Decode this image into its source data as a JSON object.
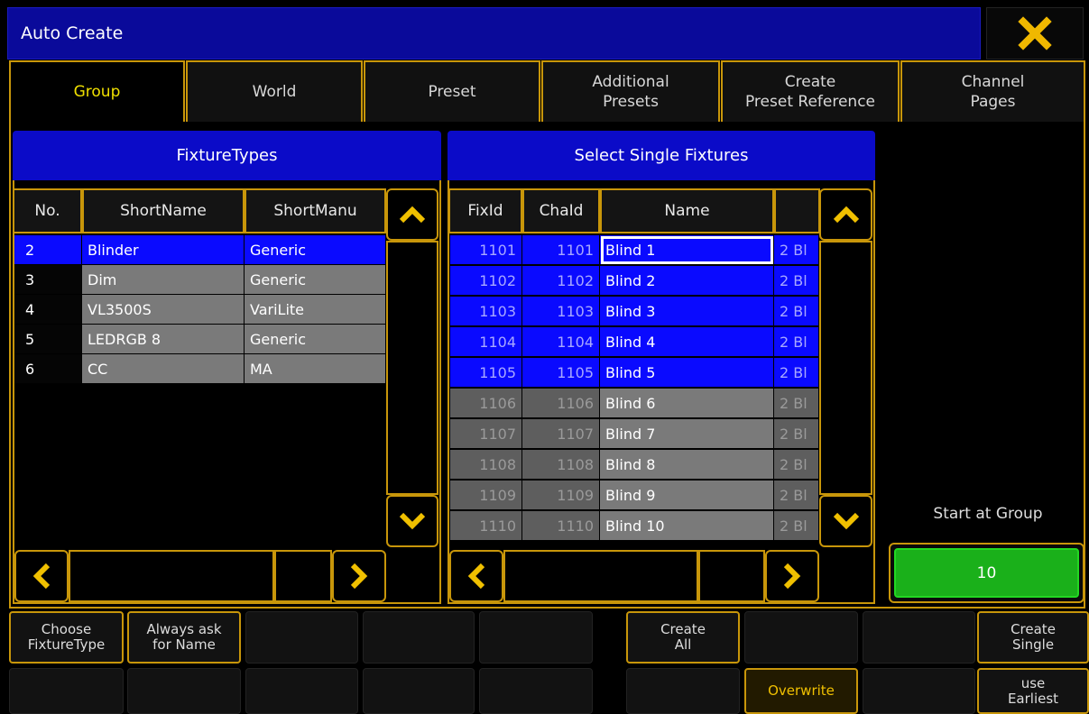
{
  "window": {
    "title": "Auto Create",
    "close_icon": "close-icon"
  },
  "tabs": [
    {
      "label": "Group",
      "active": true
    },
    {
      "label": "World"
    },
    {
      "label": "Preset"
    },
    {
      "label": "Additional\nPresets"
    },
    {
      "label": "Create\nPreset Reference"
    },
    {
      "label": "Channel\nPages"
    }
  ],
  "fixture_types": {
    "title": "FixtureTypes",
    "columns": [
      "No.",
      "ShortName",
      "ShortManu"
    ],
    "rows": [
      {
        "no": "2",
        "name": "Blinder",
        "manu": "Generic",
        "selected": true
      },
      {
        "no": "3",
        "name": "Dim",
        "manu": "Generic"
      },
      {
        "no": "4",
        "name": "VL3500S",
        "manu": "VariLite"
      },
      {
        "no": "5",
        "name": "LEDRGB 8",
        "manu": "Generic"
      },
      {
        "no": "6",
        "name": "CC",
        "manu": "MA"
      }
    ]
  },
  "single_fixtures": {
    "title": "Select Single Fixtures",
    "columns": [
      "FixId",
      "ChaId",
      "Name",
      ""
    ],
    "rows": [
      {
        "fix": "1101",
        "cha": "1101",
        "name": "Blind 1",
        "extra": "2 Bl",
        "selected": true,
        "focused": true
      },
      {
        "fix": "1102",
        "cha": "1102",
        "name": "Blind 2",
        "extra": "2 Bl",
        "selected": true
      },
      {
        "fix": "1103",
        "cha": "1103",
        "name": "Blind 3",
        "extra": "2 Bl",
        "selected": true
      },
      {
        "fix": "1104",
        "cha": "1104",
        "name": "Blind 4",
        "extra": "2 Bl",
        "selected": true
      },
      {
        "fix": "1105",
        "cha": "1105",
        "name": "Blind 5",
        "extra": "2 Bl",
        "selected": true
      },
      {
        "fix": "1106",
        "cha": "1106",
        "name": "Blind 6",
        "extra": "2 Bl"
      },
      {
        "fix": "1107",
        "cha": "1107",
        "name": "Blind 7",
        "extra": "2 Bl"
      },
      {
        "fix": "1108",
        "cha": "1108",
        "name": "Blind 8",
        "extra": "2 Bl"
      },
      {
        "fix": "1109",
        "cha": "1109",
        "name": "Blind 9",
        "extra": "2 Bl"
      },
      {
        "fix": "1110",
        "cha": "1110",
        "name": "Blind 10",
        "extra": "2 Bl"
      }
    ]
  },
  "start_at_group": {
    "label": "Start at Group",
    "value": "10"
  },
  "buttons": {
    "choose_fixture_type": "Choose\nFixtureType",
    "always_ask": "Always ask\nfor Name",
    "create_all": "Create\nAll",
    "create_single": "Create\nSingle",
    "overwrite": "Overwrite",
    "use_earliest": "use\nEarliest"
  },
  "colors": {
    "accent": "#c8960a",
    "title_bg": "#0a0a9a",
    "header_bg": "#0b0bc8",
    "selected_row": "#0a0aff",
    "unselected_row": "#7a7a7a",
    "active_tab_text": "#f0e000",
    "start_button": "#1ab01a",
    "close_icon": "#f0b800"
  },
  "icons": {
    "scroll_up": "chevron-up-icon",
    "scroll_down": "chevron-down-icon",
    "scroll_left": "chevron-left-icon",
    "scroll_right": "chevron-right-icon"
  }
}
